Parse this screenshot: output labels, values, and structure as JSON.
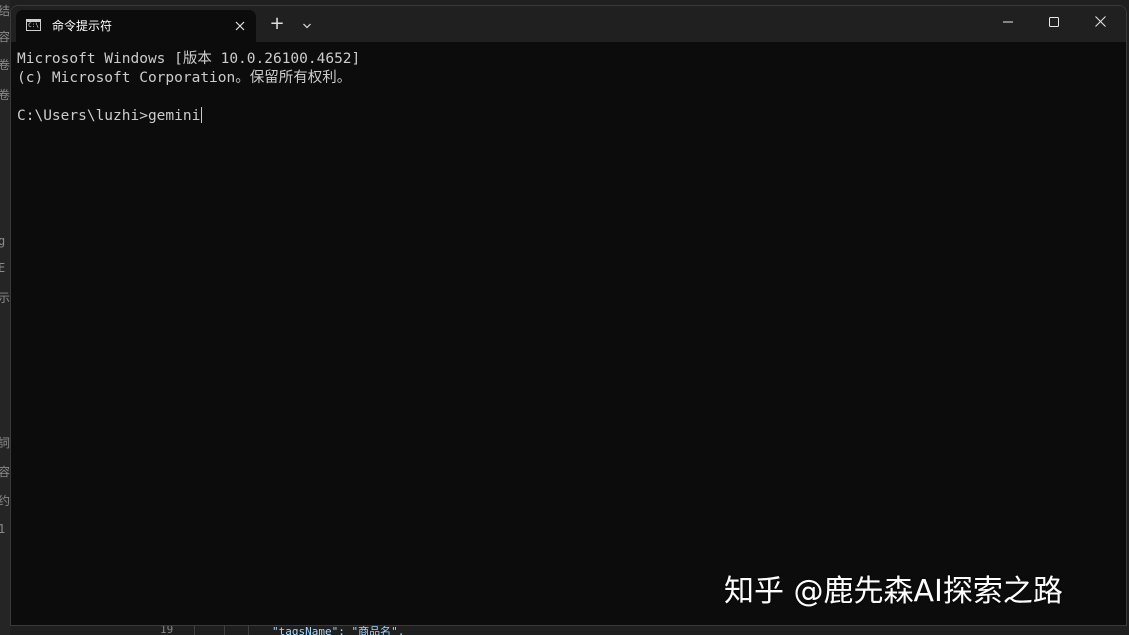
{
  "window": {
    "tab_title": "命令提示符",
    "tab_icon_glyph": "C:\\",
    "new_tab_symbol": "+"
  },
  "terminal": {
    "lines": [
      "Microsoft Windows [版本 10.0.26100.4652]",
      "(c) Microsoft Corporation。保留所有权利。"
    ],
    "prompt": "C:\\Users\\luzhi>",
    "input": "gemini"
  },
  "background": {
    "left_fragments": [
      "结",
      "容",
      "卷",
      "卷",
      "g",
      "E",
      "示",
      "詞",
      "容",
      "约",
      "1"
    ],
    "bottom_line_number": "19",
    "bottom_code": "\"tagsName\": \"商品名\","
  },
  "watermark": {
    "text": "知乎 @鹿先森AI探索之路"
  },
  "colors": {
    "terminal_bg": "#0c0c0c",
    "titlebar_bg": "#202020",
    "text": "#cccccc"
  }
}
